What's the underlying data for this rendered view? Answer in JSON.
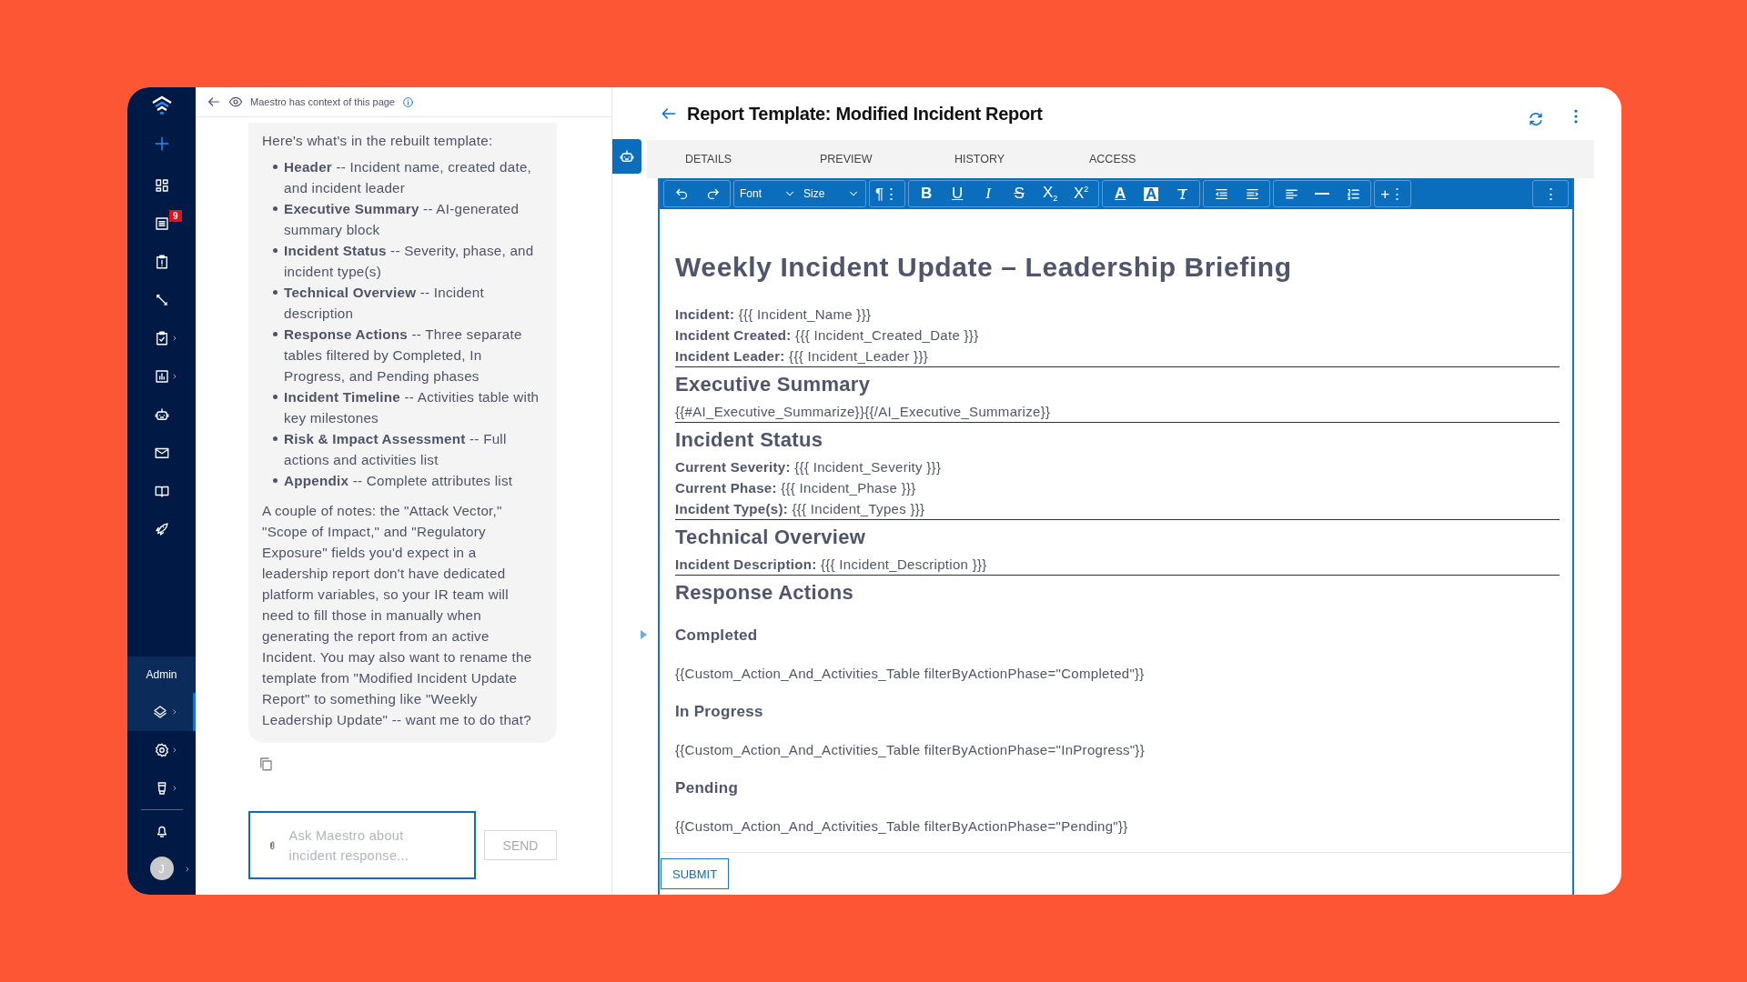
{
  "sidebar": {
    "main_items": [
      {
        "selected": false,
        "submenu": false
      },
      {
        "selected": false,
        "submenu": false,
        "badge": "9"
      },
      {
        "selected": false,
        "submenu": false
      },
      {
        "selected": false,
        "submenu": false
      },
      {
        "selected": false,
        "submenu": true
      },
      {
        "selected": false,
        "submenu": true
      },
      {
        "selected": false,
        "submenu": false
      },
      {
        "selected": false,
        "submenu": false
      },
      {
        "selected": false,
        "submenu": false
      },
      {
        "selected": false,
        "submenu": false
      }
    ],
    "admin_label": "Admin",
    "admin_items": [
      {
        "selected": true,
        "submenu": true
      },
      {
        "selected": false,
        "submenu": true
      },
      {
        "selected": false,
        "submenu": true
      }
    ],
    "avatar": "J"
  },
  "chat": {
    "context_note": "Maestro has context of this page",
    "intro": "Here's what's in the rebuilt template:",
    "bullets": [
      "**Header** -- Incident name, created date, and incident leader",
      "**Executive Summary** -- AI-generated summary block",
      "**Incident Status** -- Severity, phase, and incident type(s)",
      "**Technical Overview** -- Incident description",
      "**Response Actions** -- Three separate tables filtered by Completed, In Progress, and Pending phases",
      "**Incident Timeline** -- Activities table with key milestones",
      "**Risk & Impact Assessment** -- Full actions and activities list",
      "**Appendix** -- Complete attributes list"
    ],
    "closing": "A couple of notes: the \"Attack Vector,\" \"Scope of Impact,\" and \"Regulatory Exposure\" fields you'd expect in a leadership report don't have dedicated platform variables, so your IR team will need to fill those in manually when generating the report from an active Incident. You may also want to rename the template from \"Modified Incident Update Report\" to something like \"Weekly Leadership Update\" -- want me to do that?",
    "input": {
      "placeholder": "Ask Maestro about incident response..."
    },
    "send_button": "SEND"
  },
  "report": {
    "title": "Report Template: Modified Incident Report",
    "tabs": [
      "DETAILS",
      "PREVIEW",
      "HISTORY",
      "ACCESS"
    ],
    "toolbar": [
      {
        "items": [
          {
            "kind": "icon"
          },
          {
            "kind": "icon"
          }
        ]
      },
      {
        "items": [
          {
            "kind": "dropdown",
            "label": "Font"
          },
          {
            "kind": "dropdown",
            "label": "Size"
          }
        ]
      },
      {
        "items": [
          {
            "kind": "text",
            "label": "¶⋮"
          }
        ]
      },
      {
        "items": [
          {
            "kind": "text",
            "label": "B"
          },
          {
            "kind": "text",
            "label": "U"
          },
          {
            "kind": "text",
            "label": "I"
          },
          {
            "kind": "text",
            "label": "S"
          },
          {
            "kind": "text",
            "label": "X$_{2}$"
          },
          {
            "kind": "text",
            "label": "X$^{2}$"
          }
        ]
      },
      {
        "items": [
          {
            "kind": "text",
            "label": "A"
          },
          {
            "kind": "text",
            "label": "A"
          },
          {
            "kind": "icon"
          }
        ]
      },
      {
        "items": [
          {
            "kind": "icon"
          },
          {
            "kind": "icon"
          }
        ]
      },
      {
        "items": [
          {
            "kind": "icon"
          },
          {
            "kind": "icon"
          },
          {
            "kind": "icon"
          }
        ]
      },
      {
        "items": [
          {
            "kind": "text",
            "label": "+⋮"
          }
        ]
      },
      {
        "items": [
          {
            "kind": "text",
            "label": "⋮"
          }
        ]
      }
    ],
    "document": {
      "title": "Weekly Incident Update – Leadership Briefing",
      "sections": [
        {
          "blocks": [
            {
              "kind": "field",
              "text": "**Incident:** {{{ Incident_Name }}}"
            },
            {
              "kind": "field",
              "text": "**Incident Created:** {{{ Incident_Created_Date }}}"
            },
            {
              "kind": "field",
              "text": "**Incident Leader:** {{{ Incident_Leader }}}"
            }
          ],
          "divider_after": true
        },
        {
          "heading": "Executive Summary",
          "blocks": [
            {
              "kind": "field",
              "text": "{{#AI_Executive_Summarize}}{{/AI_Executive_Summarize}}"
            }
          ],
          "divider_after": true
        },
        {
          "heading": "Incident Status",
          "blocks": [
            {
              "kind": "field",
              "text": "**Current Severity:** {{{ Incident_Severity }}}"
            },
            {
              "kind": "field",
              "text": "**Current Phase:** {{{ Incident_Phase }}}"
            },
            {
              "kind": "field",
              "text": "**Incident Type(s):** {{{ Incident_Types }}}"
            }
          ],
          "divider_after": true
        },
        {
          "heading": "Technical Overview",
          "blocks": [
            {
              "kind": "field",
              "text": "**Incident Description:** {{{ Incident_Description }}}"
            }
          ],
          "divider_after": true
        },
        {
          "heading": "Response Actions",
          "blocks": [
            {
              "kind": "subheading",
              "text": "Completed"
            },
            {
              "kind": "code",
              "text": "{{Custom_Action_And_Activities_Table filterByActionPhase=\"Completed\"}}"
            },
            {
              "kind": "subheading",
              "text": "In Progress"
            },
            {
              "kind": "code",
              "text": "{{Custom_Action_And_Activities_Table filterByActionPhase=\"InProgress\"}}"
            },
            {
              "kind": "subheading",
              "text": "Pending"
            },
            {
              "kind": "code",
              "text": "{{Custom_Action_And_Activities_Table filterByActionPhase=\"Pending\"}}"
            }
          ]
        }
      ]
    },
    "submit_button": "SUBMIT"
  }
}
